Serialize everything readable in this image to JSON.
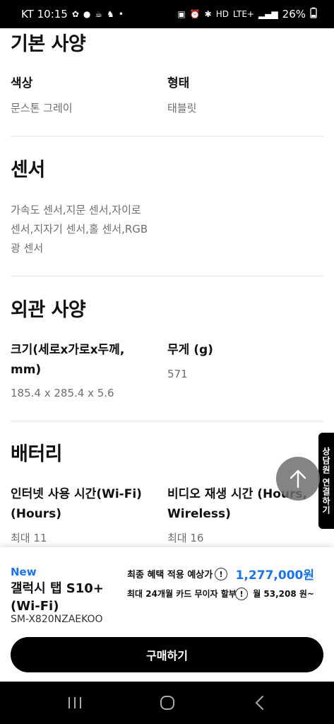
{
  "status_bar": {
    "carrier_time": "KT 10:15",
    "left_icons": [
      "settings-icon",
      "talk-icon",
      "cafe-icon",
      "alarm-icon"
    ],
    "dot": "•",
    "network": "LTE+",
    "battery": "26%"
  },
  "specs": {
    "basic": {
      "title": "기본 사양",
      "color_label": "색상",
      "color_value": "문스톤 그레이",
      "form_label": "형태",
      "form_value": "태블릿"
    },
    "sensor": {
      "title": "센서",
      "lines": [
        "가속도 센서,지문 센서,자이로",
        "센서,지자기 센서,홀 센서,RGB",
        "광 센서"
      ]
    },
    "exterior": {
      "title": "외관 사양",
      "size_label_lines": [
        "크기(세로x가로x두께,",
        "mm)"
      ],
      "size_value": "185.4 x 285.4 x 5.6",
      "weight_label": "무게 (g)",
      "weight_value": "571"
    },
    "battery": {
      "title": "배터리",
      "internet_label_lines": [
        "인터넷 사용 시간(Wi-Fi)",
        "(Hours)"
      ],
      "internet_value": "최대 11",
      "video_label_lines": [
        "비디오 재생 시간 (Hours,",
        "Wireless)"
      ],
      "video_value": "최대 16"
    }
  },
  "side_tab": {
    "label": "상담원 연결하기"
  },
  "buy_panel": {
    "badge": "New",
    "product_name": "갤럭시 탭 S10+ (Wi-Fi)",
    "sku": "SM-X820NZAEKOO",
    "price_label": "최종 혜택 적용 예상가",
    "price_value": "1,277,000원",
    "installment_label": "최대 24개월 카드 무이자 할부",
    "installment_value": "월 53,208 원~",
    "info_glyph": "!",
    "buy_button": "구매하기"
  },
  "colors": {
    "accent": "#1a73e8",
    "text": "#111111",
    "muted": "#6e6e6e"
  }
}
